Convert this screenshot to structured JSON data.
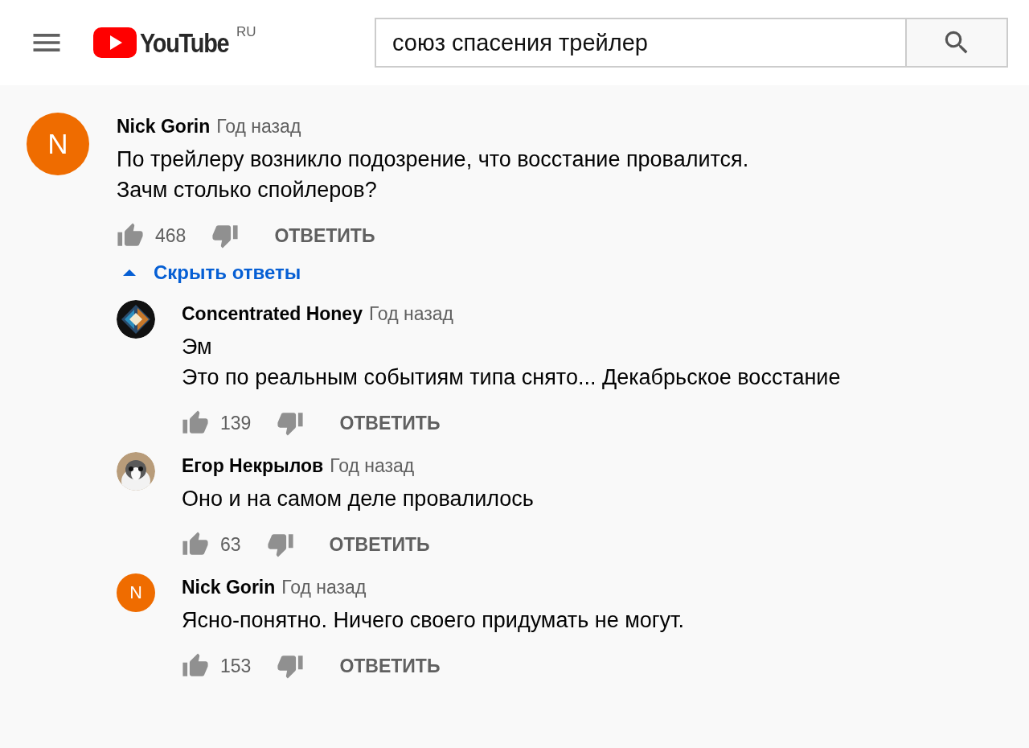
{
  "header": {
    "logo_text": "YouTube",
    "region": "RU",
    "search": {
      "value": "союз спасения трейлер"
    }
  },
  "comment": {
    "author": "Nick Gorin",
    "time": "Год назад",
    "avatar": {
      "kind": "letter",
      "letter": "N",
      "color": "#ef6c00"
    },
    "lines": [
      "По трейлеру возникло подозрение, что восстание провалится.",
      "Зачм столько спойлеров?"
    ],
    "likes": "468",
    "reply_label": "ОТВЕТИТЬ",
    "replies_toggle": {
      "label": "Скрыть ответы",
      "expanded": true
    },
    "replies": [
      {
        "author": "Concentrated Honey",
        "time": "Год назад",
        "avatar": {
          "kind": "picture"
        },
        "lines": [
          "Эм",
          "Это по реальным событиям типа снято... Декабрьское восстание"
        ],
        "likes": "139",
        "reply_label": "ОТВЕТИТЬ"
      },
      {
        "author": "Егор Некрылов",
        "time": "Год назад",
        "avatar": {
          "kind": "picture"
        },
        "lines": [
          "Оно и на самом деле провалилось"
        ],
        "likes": "63",
        "reply_label": "ОТВЕТИТЬ"
      },
      {
        "author": "Nick Gorin",
        "time": "Год назад",
        "avatar": {
          "kind": "letter",
          "letter": "N",
          "color": "#ef6c00"
        },
        "lines": [
          "Ясно-понятно. Ничего своего придумать не могут."
        ],
        "likes": "153",
        "reply_label": "ОТВЕТИТЬ"
      }
    ]
  }
}
